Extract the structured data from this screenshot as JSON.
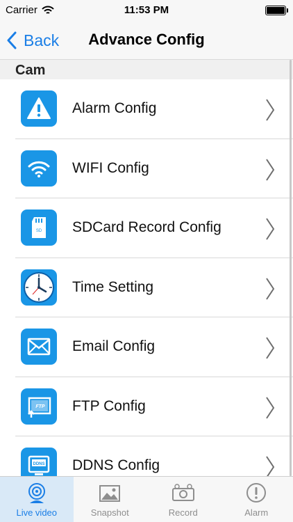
{
  "status_bar": {
    "carrier": "Carrier",
    "time": "11:53 PM"
  },
  "nav": {
    "back_label": "Back",
    "title": "Advance Config"
  },
  "section": {
    "title": "Cam"
  },
  "items": [
    {
      "label": "Alarm Config",
      "icon": "alarm-warning-icon"
    },
    {
      "label": "WIFI Config",
      "icon": "wifi-icon"
    },
    {
      "label": "SDCard Record Config",
      "icon": "sdcard-icon"
    },
    {
      "label": "Time Setting",
      "icon": "clock-icon"
    },
    {
      "label": "Email Config",
      "icon": "envelope-icon"
    },
    {
      "label": "FTP Config",
      "icon": "ftp-icon"
    },
    {
      "label": "DDNS Config",
      "icon": "ddns-icon"
    }
  ],
  "tabs": [
    {
      "label": "Live video",
      "icon": "webcam-icon",
      "active": true
    },
    {
      "label": "Snapshot",
      "icon": "picture-icon",
      "active": false
    },
    {
      "label": "Record",
      "icon": "video-camera-icon",
      "active": false
    },
    {
      "label": "Alarm",
      "icon": "exclamation-circle-icon",
      "active": false
    }
  ],
  "colors": {
    "accent": "#1a7ee6",
    "icon_bg": "#1a96e6",
    "tab_active_bg": "#d9e9f7"
  }
}
